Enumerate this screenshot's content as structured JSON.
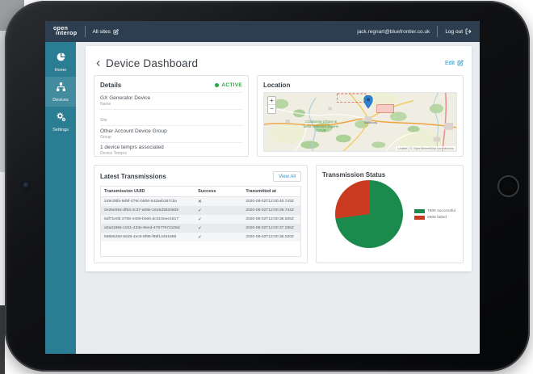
{
  "topbar": {
    "logo_line1": "open",
    "logo_line2": "interop",
    "site_label": "All sites",
    "user_email": "jack.regnart@bluefrontier.co.uk",
    "logout_label": "Log out"
  },
  "sidebar": {
    "items": [
      {
        "label": "Home",
        "icon": "pie-chart-icon"
      },
      {
        "label": "Devices",
        "icon": "sitemap-icon"
      },
      {
        "label": "Settings",
        "icon": "cogs-icon"
      }
    ]
  },
  "page": {
    "title": "Device Dashboard",
    "edit_label": "Edit"
  },
  "panels": {
    "details": {
      "title": "Details",
      "status_label": "ACTIVE",
      "status_color": "#28a745",
      "fields": [
        {
          "value": "GX Generator Device",
          "label": "Name"
        },
        {
          "value": "",
          "label": "Site"
        },
        {
          "value": "Other Account Device Group",
          "label": "Group"
        },
        {
          "value": "1 device temprs associated",
          "label": "Device Temprs"
        }
      ]
    },
    "location": {
      "title": "Location",
      "zoom_in_label": "+",
      "zoom_out_label": "−",
      "city_label": "Salisbury",
      "area_label": "Cranborne Chase & West Wiltshire Downs AONB",
      "attribution": "Leaflet | © OpenStreetMap contributors"
    },
    "transmissions": {
      "title": "Latest Transmissions",
      "view_all_label": "View All",
      "columns": [
        "Transmission UUID",
        "Success",
        "Transmitted at"
      ],
      "rows": [
        {
          "uuid": "249c08fa-9d9f-479c-b606-542aeb267cba",
          "mark": "✕",
          "transmitted_at": "2020-08-02T12:00:40.743Z"
        },
        {
          "uuid": "0e26e054-df53-4c37-a08e-1915d3820509",
          "mark": "✓",
          "transmitted_at": "2020-08-02T12:00:39.744Z"
        },
        {
          "uuid": "8df71e0b-2708-4400-b0eb-dc010eee1617",
          "mark": "✓",
          "transmitted_at": "2020-08-02T12:00:38.505Z"
        },
        {
          "uuid": "a0a31984-1931-433e-9eed-47977972108d",
          "mark": "✓",
          "transmitted_at": "2020-08-02T12:00:37.296Z"
        },
        {
          "uuid": "59895250-5629-4ec9-8f95-f99f14491896",
          "mark": "✓",
          "transmitted_at": "2020-08-02T12:00:36.020Z"
        }
      ]
    },
    "status": {
      "title": "Transmission Status"
    }
  },
  "chart_data": {
    "type": "pie",
    "title": "Transmission Status",
    "legend_position": "right",
    "slices": [
      {
        "label": "7805 successful",
        "value": 7805,
        "color": "#1b8a4d"
      },
      {
        "label": "2906 failed",
        "value": 2906,
        "color": "#c93a20"
      }
    ]
  }
}
